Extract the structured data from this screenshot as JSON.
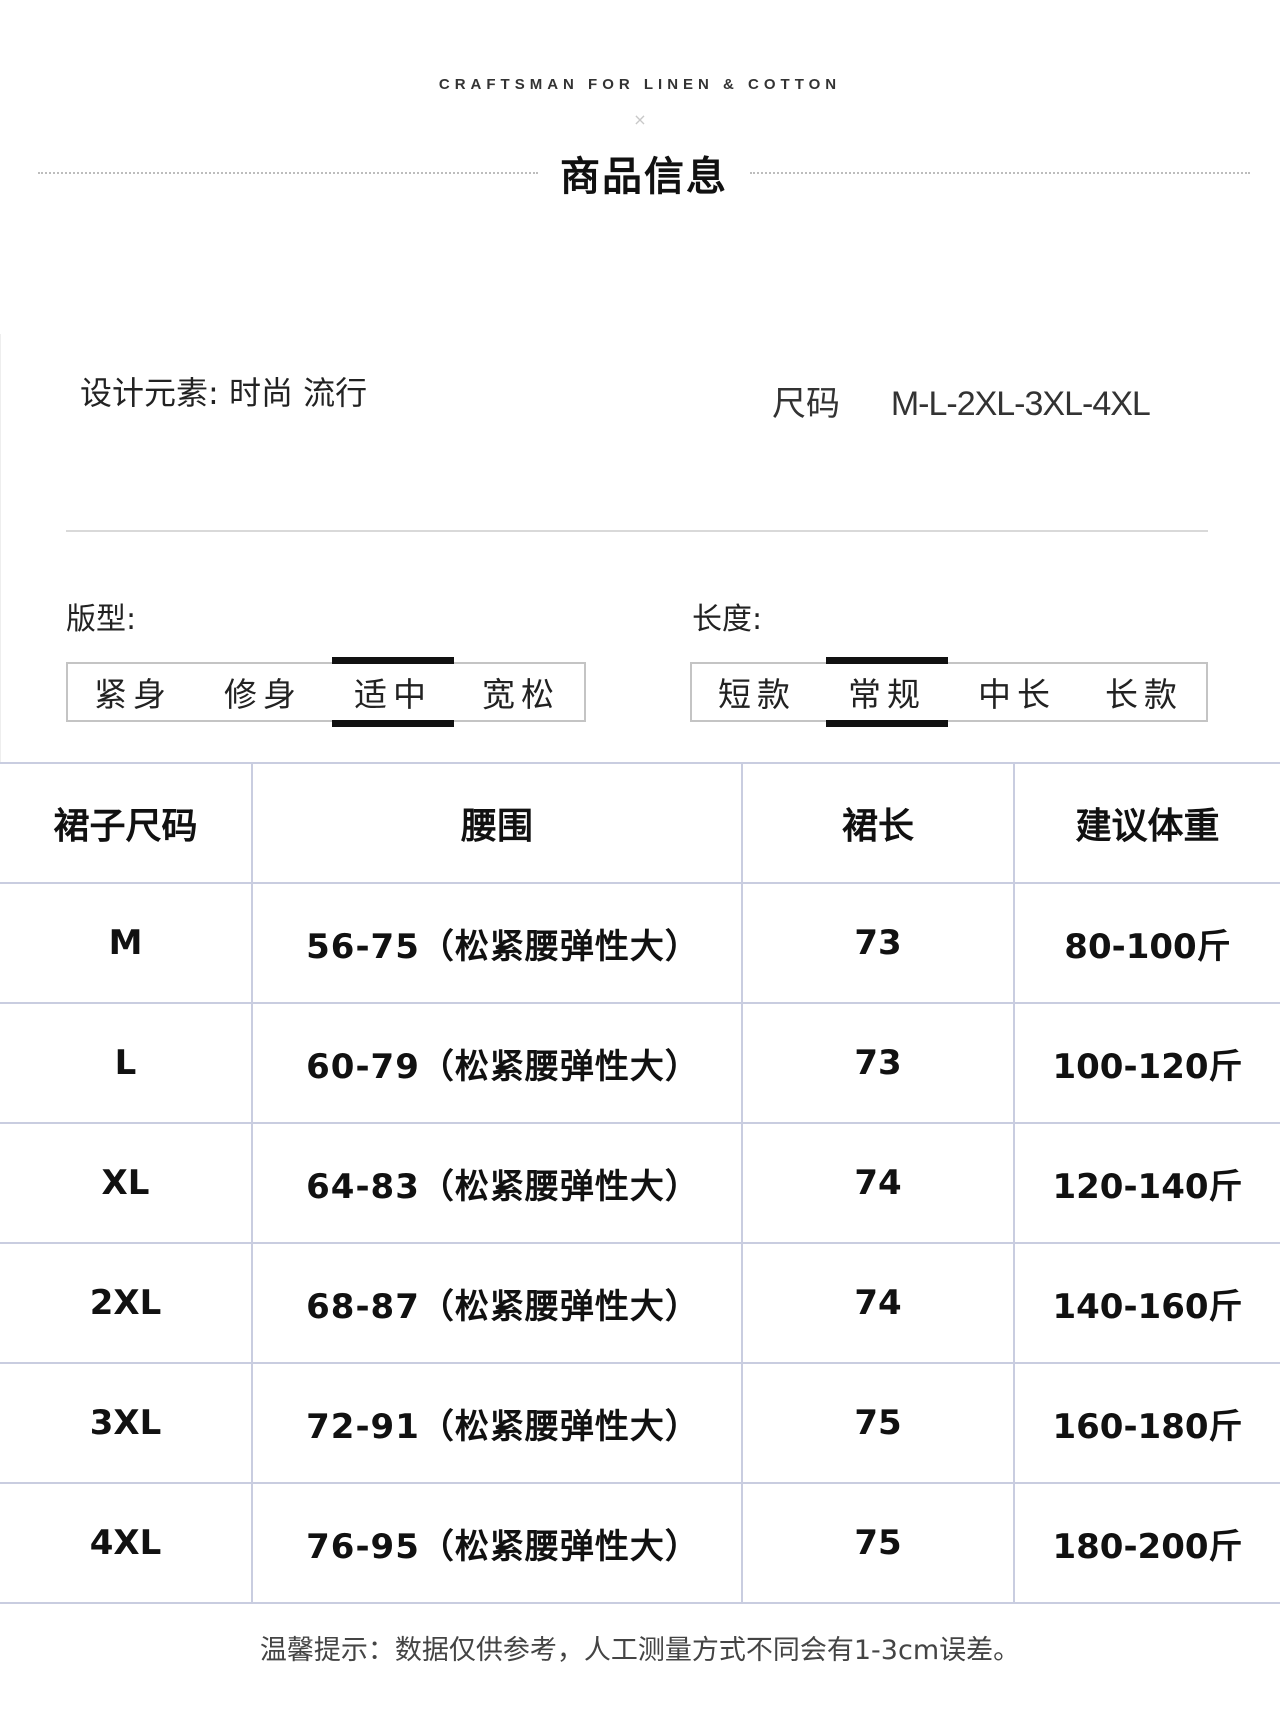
{
  "header": {
    "brand_line": "CRAFTSMAN FOR LINEN & COTTON",
    "cross": "×",
    "title": "商品信息"
  },
  "attributes": {
    "design_label": "设计元素:",
    "design_value": "时尚 流行",
    "size_label": "尺码",
    "size_values": "M-L-2XL-3XL-4XL"
  },
  "fit": {
    "label": "版型:",
    "options": [
      "紧身",
      "修身",
      "适中",
      "宽松"
    ],
    "selected": "适中"
  },
  "length": {
    "label": "长度:",
    "options": [
      "短款",
      "常规",
      "中长",
      "长款"
    ],
    "selected": "常规"
  },
  "size_table": {
    "headers": [
      "裙子尺码",
      "腰围",
      "裙长",
      "建议体重"
    ],
    "rows": [
      {
        "size": "M",
        "waist": "56-75（松紧腰弹性大）",
        "length": "73",
        "weight": "80-100斤"
      },
      {
        "size": "L",
        "waist": "60-79（松紧腰弹性大）",
        "length": "73",
        "weight": "100-120斤"
      },
      {
        "size": "XL",
        "waist": "64-83（松紧腰弹性大）",
        "length": "74",
        "weight": "120-140斤"
      },
      {
        "size": "2XL",
        "waist": "68-87（松紧腰弹性大）",
        "length": "74",
        "weight": "140-160斤"
      },
      {
        "size": "3XL",
        "waist": "72-91（松紧腰弹性大）",
        "length": "75",
        "weight": "160-180斤"
      },
      {
        "size": "4XL",
        "waist": "76-95（松紧腰弹性大）",
        "length": "75",
        "weight": "180-200斤"
      }
    ]
  },
  "tip": "温馨提示：数据仅供参考，人工测量方式不同会有1-3cm误差。",
  "colors": {
    "selected_bar": "#111111",
    "table_border": "#c9cde0"
  }
}
